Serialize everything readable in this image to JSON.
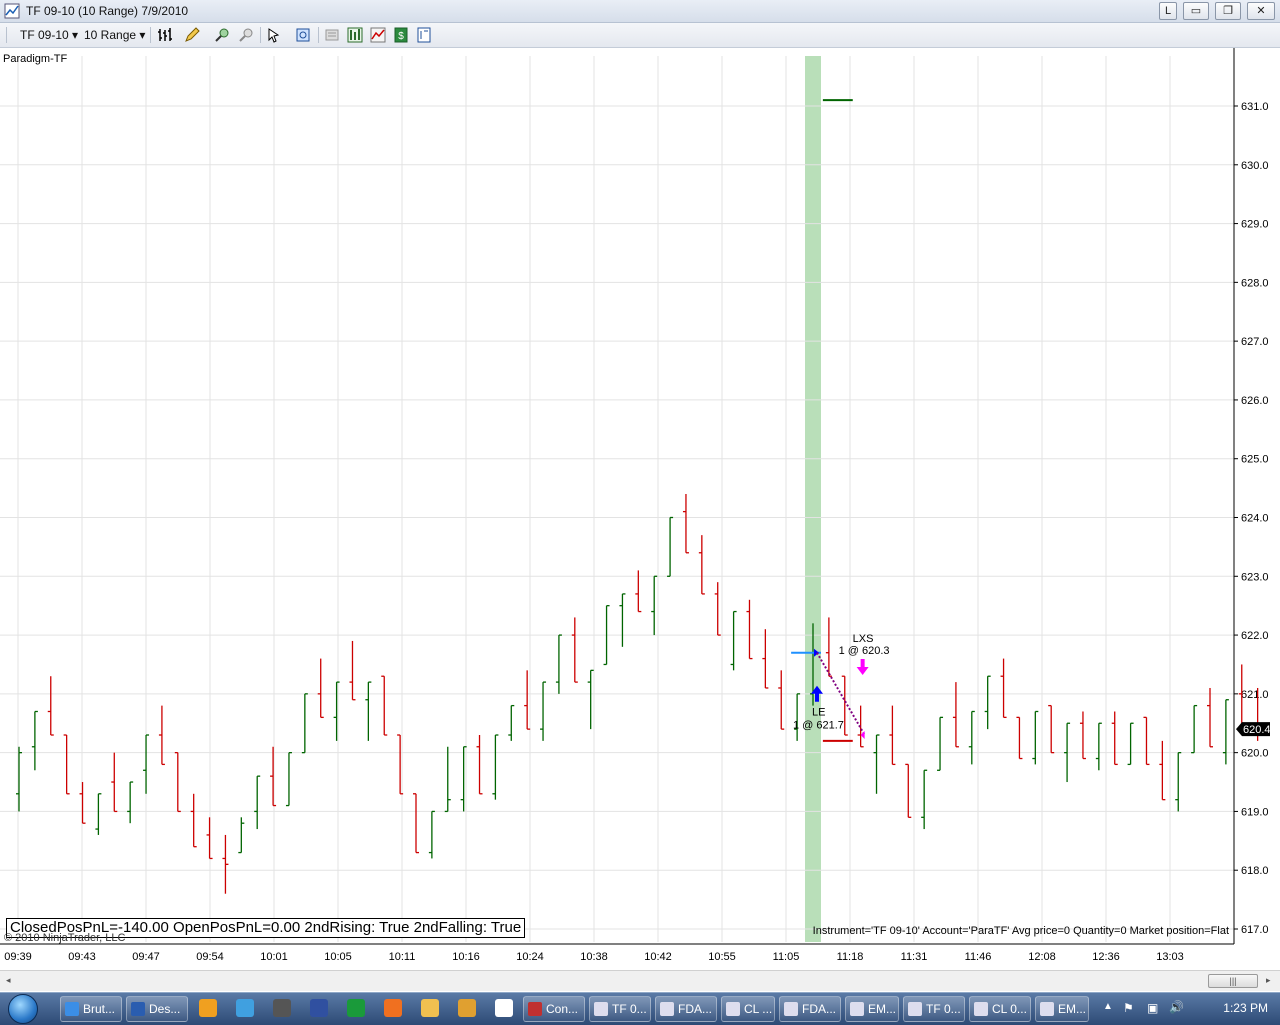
{
  "window": {
    "title": "TF 09-10 (10 Range)  7/9/2010",
    "buttons": [
      "L",
      "▭",
      "❐",
      "✕"
    ]
  },
  "toolbar": {
    "instrument": "TF 09-10",
    "period": "10 Range"
  },
  "chart": {
    "indicator_name": "Paradigm-TF",
    "pnl_text": "ClosedPosPnL=-140.00 OpenPosPnL=0.00 2ndRising: True 2ndFalling: True",
    "copyright": "© 2010 NinjaTrader, LLC",
    "instrument_info": "Instrument='TF 09-10' Account='ParaTF' Avg price=0 Quantity=0 Market position=Flat",
    "last_price_label": "620.4",
    "entry_label": "LE",
    "entry_fill": "1 @ 621.7",
    "exit_label": "LXS",
    "exit_fill": "1 @ 620.3",
    "colors": {
      "up_bar": "#006400",
      "down_bar": "#cc0000",
      "session_highlight": "#b9dfb9",
      "grid": "#e3e3e3",
      "entry_arrow": "#0000ff",
      "exit_arrow": "#ff00ff"
    }
  },
  "chart_data": {
    "type": "ohlc",
    "title": "TF 09-10 (10 Range)",
    "y_ticks": [
      "617.0",
      "618.0",
      "619.0",
      "620.0",
      "621.0",
      "622.0",
      "623.0",
      "624.0",
      "625.0",
      "626.0",
      "627.0",
      "628.0",
      "629.0",
      "630.0",
      "631.0"
    ],
    "ylim": [
      616.9,
      631.7
    ],
    "x_ticks": [
      "09:39",
      "09:43",
      "09:47",
      "09:54",
      "10:01",
      "10:05",
      "10:11",
      "10:16",
      "10:24",
      "10:38",
      "10:42",
      "10:55",
      "11:05",
      "11:18",
      "11:31",
      "11:46",
      "12:08",
      "12:36",
      "13:03"
    ],
    "grid": true,
    "bars": [
      {
        "o": 619.3,
        "h": 620.1,
        "l": 619.0,
        "c": 620.0
      },
      {
        "o": 620.1,
        "h": 620.7,
        "l": 619.7,
        "c": 620.7
      },
      {
        "o": 620.7,
        "h": 621.3,
        "l": 620.3,
        "c": 620.3
      },
      {
        "o": 620.3,
        "h": 620.3,
        "l": 619.3,
        "c": 619.3
      },
      {
        "o": 619.3,
        "h": 619.5,
        "l": 618.8,
        "c": 618.8
      },
      {
        "o": 618.7,
        "h": 619.3,
        "l": 618.6,
        "c": 619.3
      },
      {
        "o": 619.5,
        "h": 620.0,
        "l": 619.0,
        "c": 619.0
      },
      {
        "o": 619.0,
        "h": 619.5,
        "l": 618.8,
        "c": 619.5
      },
      {
        "o": 619.7,
        "h": 620.3,
        "l": 619.3,
        "c": 620.3
      },
      {
        "o": 620.3,
        "h": 620.8,
        "l": 619.8,
        "c": 619.8
      },
      {
        "o": 620.0,
        "h": 620.0,
        "l": 619.0,
        "c": 619.0
      },
      {
        "o": 619.0,
        "h": 619.3,
        "l": 618.4,
        "c": 618.4
      },
      {
        "o": 618.6,
        "h": 618.9,
        "l": 618.2,
        "c": 618.2
      },
      {
        "o": 618.2,
        "h": 618.6,
        "l": 617.6,
        "c": 618.1
      },
      {
        "o": 618.3,
        "h": 618.9,
        "l": 618.3,
        "c": 618.8
      },
      {
        "o": 619.0,
        "h": 619.6,
        "l": 618.7,
        "c": 619.6
      },
      {
        "o": 619.6,
        "h": 620.1,
        "l": 619.1,
        "c": 619.1
      },
      {
        "o": 619.1,
        "h": 620.0,
        "l": 619.1,
        "c": 620.0
      },
      {
        "o": 620.0,
        "h": 621.0,
        "l": 620.0,
        "c": 621.0
      },
      {
        "o": 621.0,
        "h": 621.6,
        "l": 620.6,
        "c": 620.6
      },
      {
        "o": 620.6,
        "h": 621.2,
        "l": 620.2,
        "c": 621.2
      },
      {
        "o": 621.2,
        "h": 621.9,
        "l": 620.9,
        "c": 620.9
      },
      {
        "o": 620.9,
        "h": 621.2,
        "l": 620.2,
        "c": 621.2
      },
      {
        "o": 621.3,
        "h": 621.3,
        "l": 620.3,
        "c": 620.3
      },
      {
        "o": 620.3,
        "h": 620.3,
        "l": 619.3,
        "c": 619.3
      },
      {
        "o": 619.3,
        "h": 619.3,
        "l": 618.3,
        "c": 618.3
      },
      {
        "o": 618.3,
        "h": 619.0,
        "l": 618.2,
        "c": 619.0
      },
      {
        "o": 619.0,
        "h": 620.1,
        "l": 619.0,
        "c": 619.2
      },
      {
        "o": 619.2,
        "h": 620.1,
        "l": 619.0,
        "c": 620.1
      },
      {
        "o": 620.1,
        "h": 620.3,
        "l": 619.3,
        "c": 619.3
      },
      {
        "o": 619.3,
        "h": 620.3,
        "l": 619.2,
        "c": 620.3
      },
      {
        "o": 620.3,
        "h": 620.8,
        "l": 620.2,
        "c": 620.8
      },
      {
        "o": 620.8,
        "h": 621.4,
        "l": 620.4,
        "c": 620.4
      },
      {
        "o": 620.4,
        "h": 621.2,
        "l": 620.2,
        "c": 621.2
      },
      {
        "o": 621.2,
        "h": 622.0,
        "l": 621.0,
        "c": 622.0
      },
      {
        "o": 622.0,
        "h": 622.3,
        "l": 621.2,
        "c": 621.2
      },
      {
        "o": 621.2,
        "h": 621.4,
        "l": 620.4,
        "c": 621.4
      },
      {
        "o": 621.5,
        "h": 622.5,
        "l": 621.5,
        "c": 622.5
      },
      {
        "o": 622.5,
        "h": 622.7,
        "l": 621.8,
        "c": 622.7
      },
      {
        "o": 622.7,
        "h": 623.1,
        "l": 622.4,
        "c": 622.4
      },
      {
        "o": 622.4,
        "h": 623.0,
        "l": 622.0,
        "c": 623.0
      },
      {
        "o": 623.0,
        "h": 624.0,
        "l": 623.0,
        "c": 624.0
      },
      {
        "o": 624.1,
        "h": 624.4,
        "l": 623.4,
        "c": 623.4
      },
      {
        "o": 623.4,
        "h": 623.7,
        "l": 622.7,
        "c": 622.7
      },
      {
        "o": 622.7,
        "h": 622.9,
        "l": 622.0,
        "c": 622.0
      },
      {
        "o": 621.5,
        "h": 622.4,
        "l": 621.4,
        "c": 622.4
      },
      {
        "o": 622.4,
        "h": 622.6,
        "l": 621.6,
        "c": 621.6
      },
      {
        "o": 621.6,
        "h": 622.1,
        "l": 621.1,
        "c": 621.1
      },
      {
        "o": 621.1,
        "h": 621.4,
        "l": 620.4,
        "c": 620.4
      },
      {
        "o": 620.4,
        "h": 621.0,
        "l": 620.2,
        "c": 621.0
      },
      {
        "o": 621.0,
        "h": 622.2,
        "l": 620.8,
        "c": 621.7
      },
      {
        "o": 621.7,
        "h": 622.3,
        "l": 621.3,
        "c": 621.3
      },
      {
        "o": 621.3,
        "h": 621.3,
        "l": 620.3,
        "c": 620.3
      },
      {
        "o": 620.3,
        "h": 620.8,
        "l": 620.1,
        "c": 620.1
      },
      {
        "o": 620.0,
        "h": 620.3,
        "l": 619.3,
        "c": 620.3
      },
      {
        "o": 620.3,
        "h": 620.8,
        "l": 619.8,
        "c": 619.8
      },
      {
        "o": 619.8,
        "h": 619.8,
        "l": 618.9,
        "c": 618.9
      },
      {
        "o": 618.9,
        "h": 619.7,
        "l": 618.7,
        "c": 619.7
      },
      {
        "o": 619.7,
        "h": 620.6,
        "l": 619.7,
        "c": 620.6
      },
      {
        "o": 620.6,
        "h": 621.2,
        "l": 620.1,
        "c": 620.1
      },
      {
        "o": 620.1,
        "h": 620.7,
        "l": 619.8,
        "c": 620.7
      },
      {
        "o": 620.7,
        "h": 621.3,
        "l": 620.4,
        "c": 621.3
      },
      {
        "o": 621.3,
        "h": 621.6,
        "l": 620.6,
        "c": 620.6
      },
      {
        "o": 620.6,
        "h": 620.6,
        "l": 619.9,
        "c": 619.9
      },
      {
        "o": 619.9,
        "h": 620.7,
        "l": 619.8,
        "c": 620.7
      },
      {
        "o": 620.8,
        "h": 620.8,
        "l": 620.0,
        "c": 620.0
      },
      {
        "o": 620.0,
        "h": 620.5,
        "l": 619.5,
        "c": 620.5
      },
      {
        "o": 620.5,
        "h": 620.7,
        "l": 619.9,
        "c": 619.9
      },
      {
        "o": 619.9,
        "h": 620.5,
        "l": 619.7,
        "c": 620.5
      },
      {
        "o": 620.5,
        "h": 620.7,
        "l": 619.8,
        "c": 619.8
      },
      {
        "o": 619.8,
        "h": 620.5,
        "l": 619.8,
        "c": 620.5
      },
      {
        "o": 620.6,
        "h": 620.6,
        "l": 619.8,
        "c": 619.8
      },
      {
        "o": 619.8,
        "h": 620.2,
        "l": 619.2,
        "c": 619.2
      },
      {
        "o": 619.2,
        "h": 620.0,
        "l": 619.0,
        "c": 620.0
      },
      {
        "o": 620.0,
        "h": 620.8,
        "l": 620.0,
        "c": 620.8
      },
      {
        "o": 620.8,
        "h": 621.1,
        "l": 620.1,
        "c": 620.1
      },
      {
        "o": 620.0,
        "h": 620.9,
        "l": 619.8,
        "c": 620.9
      },
      {
        "o": 621.0,
        "h": 621.5,
        "l": 620.5,
        "c": 620.5
      },
      {
        "o": 620.5,
        "h": 621.1,
        "l": 620.2,
        "c": 620.4
      }
    ],
    "session_highlight_bar_index": 50,
    "trades": [
      {
        "label": "LE",
        "fill": "1 @ 621.7",
        "type": "entry-long",
        "bar_index": 50,
        "price": 621.7
      },
      {
        "label": "LXS",
        "fill": "1 @ 620.3",
        "type": "exit-long",
        "bar_index": 53,
        "price": 620.3
      }
    ],
    "order_levels": [
      {
        "price": 631.1,
        "color": "#006400",
        "start_bar": 51,
        "end_bar": 52
      },
      {
        "price": 620.2,
        "color": "#cc0000",
        "start_bar": 51,
        "end_bar": 52
      },
      {
        "price": 621.7,
        "color": "#1e90ff",
        "start_bar": 49,
        "end_bar": 50
      }
    ]
  },
  "taskbar": {
    "buttons": [
      "Brut...",
      "Des...",
      "Con...",
      "TF 0...",
      "FDA...",
      "CL ...",
      "FDA...",
      "EM...",
      "TF 0...",
      "CL 0...",
      "EM..."
    ],
    "clock": "1:23 PM"
  }
}
